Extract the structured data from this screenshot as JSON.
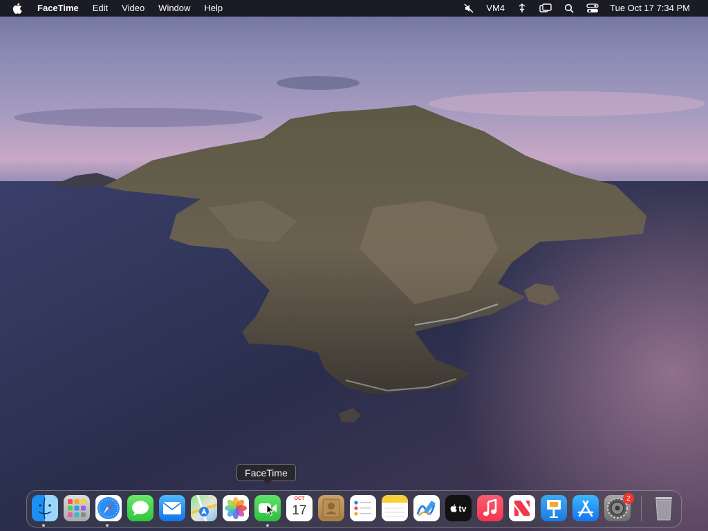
{
  "menubar": {
    "app_name": "FaceTime",
    "menus": [
      "Edit",
      "Video",
      "Window",
      "Help"
    ],
    "status": {
      "vm_label": "VM4",
      "date": "Tue Oct 17",
      "time": "7:34 PM"
    },
    "icons": [
      "apple-logo",
      "mute-icon",
      "network-icon",
      "screen-mirroring-icon",
      "search-icon",
      "control-center-icon"
    ]
  },
  "tooltip": {
    "text": "FaceTime"
  },
  "dock": {
    "items": [
      {
        "name": "Finder",
        "icon": "finder-icon",
        "running": true
      },
      {
        "name": "Launchpad",
        "icon": "launchpad-icon",
        "running": false
      },
      {
        "name": "Safari",
        "icon": "safari-icon",
        "running": true
      },
      {
        "name": "Messages",
        "icon": "messages-icon",
        "running": false
      },
      {
        "name": "Mail",
        "icon": "mail-icon",
        "running": false
      },
      {
        "name": "Maps",
        "icon": "maps-icon",
        "running": false
      },
      {
        "name": "Photos",
        "icon": "photos-icon",
        "running": false
      },
      {
        "name": "FaceTime",
        "icon": "facetime-icon",
        "running": true
      },
      {
        "name": "Calendar",
        "icon": "calendar-icon",
        "running": false,
        "month": "OCT",
        "day": "17"
      },
      {
        "name": "Contacts",
        "icon": "contacts-icon",
        "running": false
      },
      {
        "name": "Reminders",
        "icon": "reminders-icon",
        "running": false
      },
      {
        "name": "Notes",
        "icon": "notes-icon",
        "running": false
      },
      {
        "name": "Freeform",
        "icon": "freeform-icon",
        "running": false
      },
      {
        "name": "TV",
        "icon": "tv-icon",
        "running": false,
        "label": "tv"
      },
      {
        "name": "Music",
        "icon": "music-icon",
        "running": false
      },
      {
        "name": "News",
        "icon": "news-icon",
        "running": false
      },
      {
        "name": "Keynote",
        "icon": "keynote-icon",
        "running": false
      },
      {
        "name": "App Store",
        "icon": "app-store-icon",
        "running": false
      },
      {
        "name": "System Settings",
        "icon": "system-settings-icon",
        "running": false,
        "badge": "2"
      },
      {
        "name": "Trash",
        "icon": "trash-icon",
        "running": false
      }
    ]
  },
  "colors": {
    "menubar_bg": "#14141a",
    "badge_red": "#f0352c",
    "facetime_green": "#34c759"
  }
}
